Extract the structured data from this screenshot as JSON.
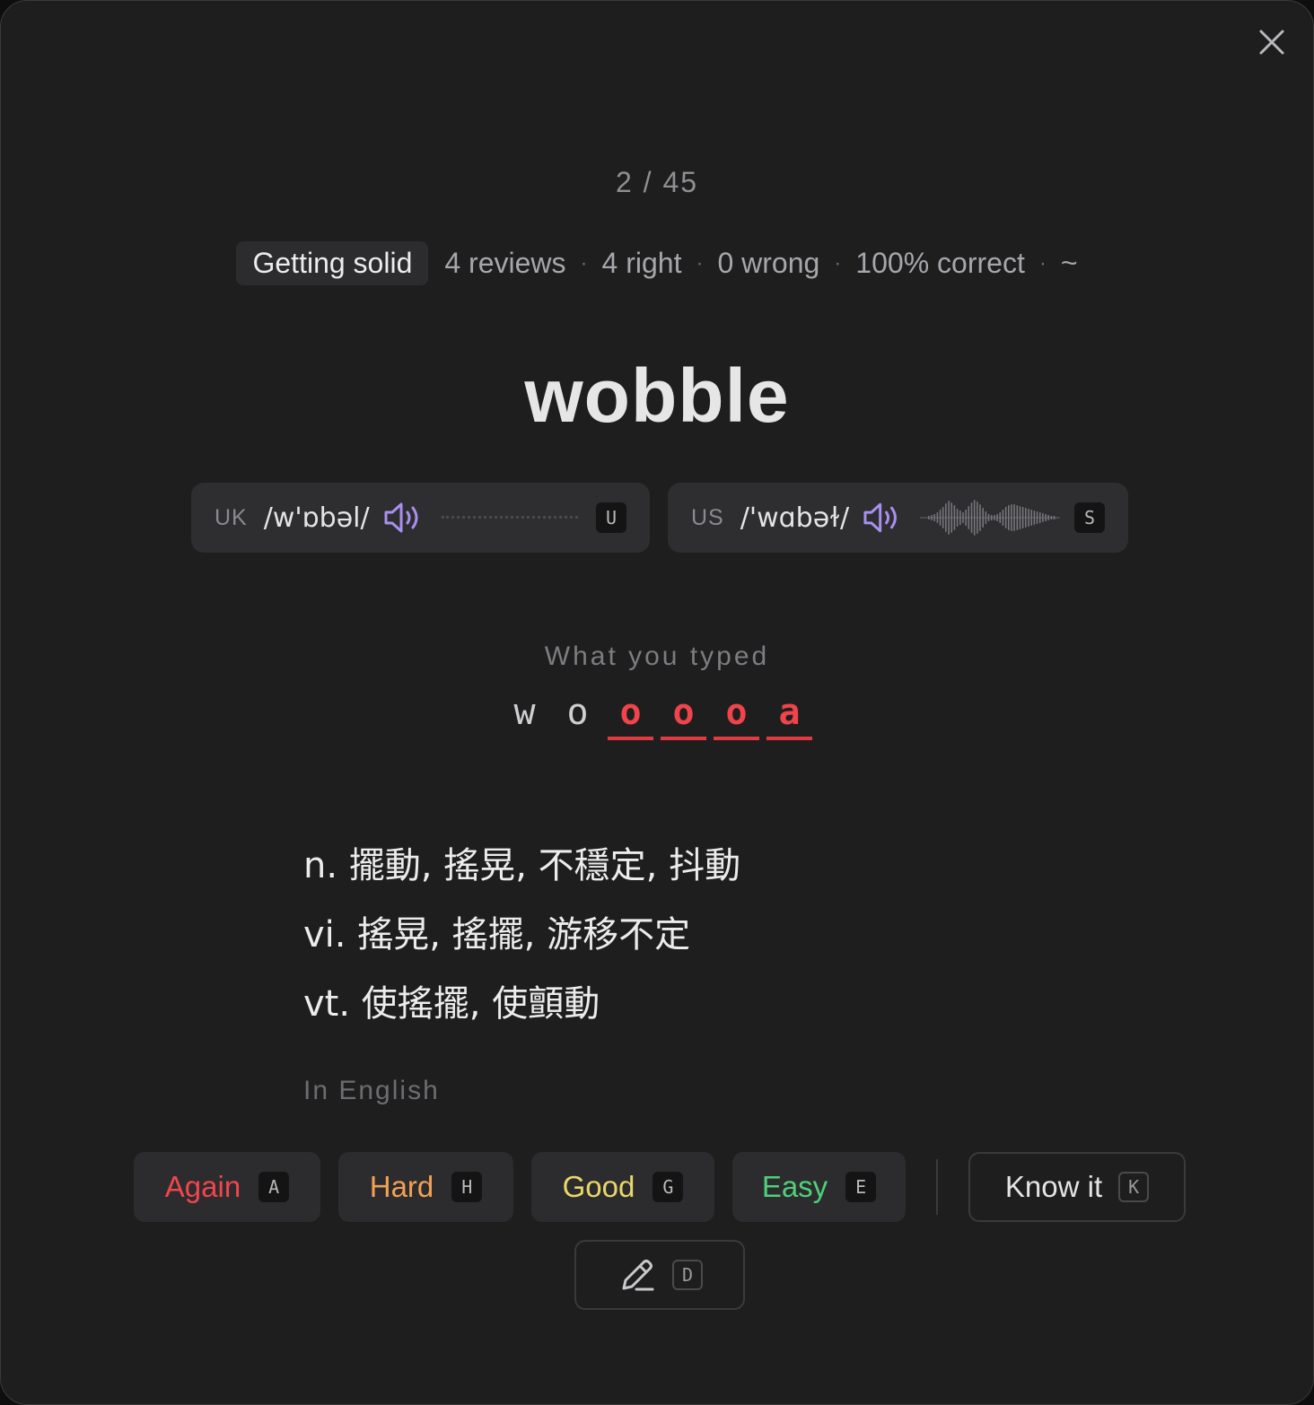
{
  "progress": {
    "text": "2 / 45"
  },
  "stats": {
    "stage": "Getting solid",
    "items": [
      "4 reviews",
      "4 right",
      "0 wrong",
      "100% correct",
      "~"
    ],
    "separator": "·"
  },
  "word": "wobble",
  "pronunciations": {
    "uk": {
      "region": "UK",
      "ipa": "/w'ɒbəl/",
      "key": "U",
      "icon": "speaker-icon"
    },
    "us": {
      "region": "US",
      "ipa": "/'wɑbəɫ/",
      "key": "S",
      "icon": "speaker-icon"
    }
  },
  "typed": {
    "label": "What you typed",
    "chars": [
      {
        "ch": "w",
        "wrong": false
      },
      {
        "ch": "o",
        "wrong": false
      },
      {
        "ch": "o",
        "wrong": true
      },
      {
        "ch": "o",
        "wrong": true
      },
      {
        "ch": "o",
        "wrong": true
      },
      {
        "ch": "a",
        "wrong": true
      }
    ]
  },
  "definitions": [
    "n. 擺動, 搖晃, 不穩定, 抖動",
    "vi. 搖晃, 搖擺, 游移不定",
    "vt. 使搖擺, 使顫動"
  ],
  "in_english_label": "In English",
  "actions": {
    "again": {
      "label": "Again",
      "key": "A",
      "color": "#f0464c"
    },
    "hard": {
      "label": "Hard",
      "key": "H",
      "color": "#f2a055"
    },
    "good": {
      "label": "Good",
      "key": "G",
      "color": "#e9d76b"
    },
    "easy": {
      "label": "Easy",
      "key": "E",
      "color": "#4fd07a"
    },
    "know": {
      "label": "Know it",
      "key": "K"
    },
    "edit": {
      "key": "D",
      "icon": "pencil-icon"
    }
  },
  "colors": {
    "accent_speaker": "#a990f0",
    "error": "#f0434a",
    "background": "#1e1e1f"
  }
}
